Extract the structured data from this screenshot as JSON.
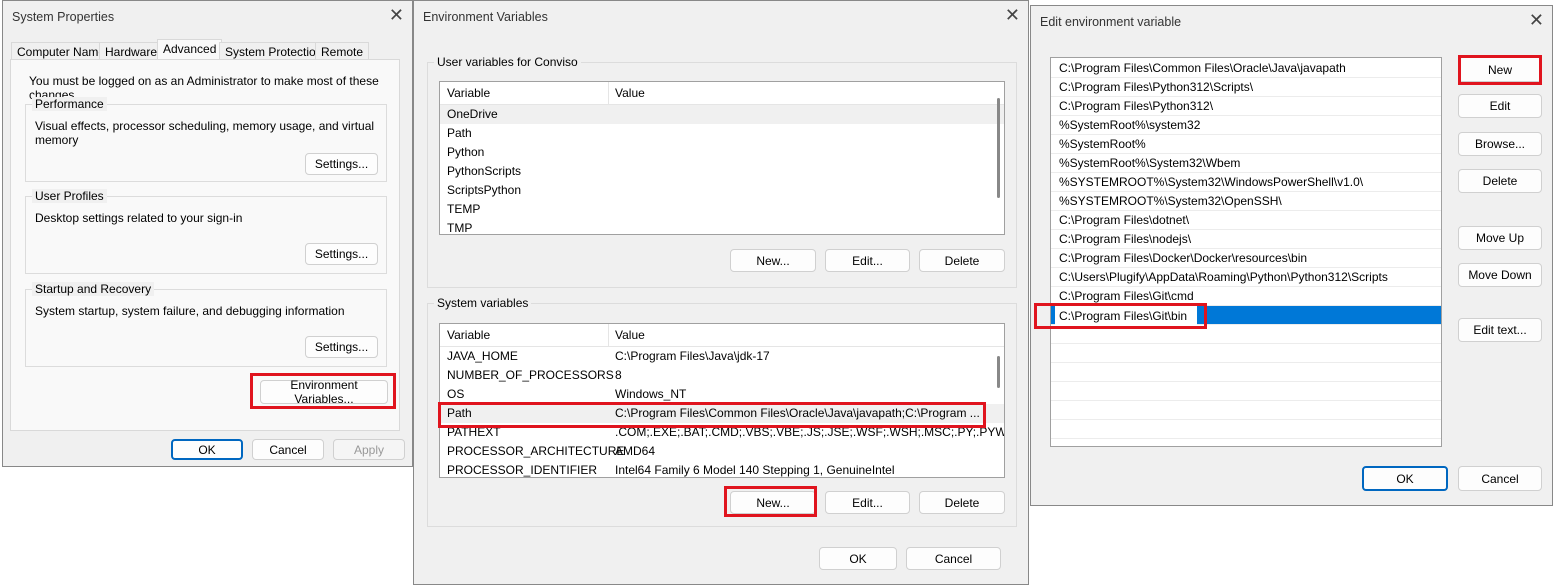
{
  "system_properties": {
    "title": "System Properties",
    "tabs": [
      "Computer Name",
      "Hardware",
      "Advanced",
      "System Protection",
      "Remote"
    ],
    "active_tab": "Advanced",
    "admin_note": "You must be logged on as an Administrator to make most of these changes.",
    "groups": [
      {
        "label": "Performance",
        "desc": "Visual effects, processor scheduling, memory usage, and virtual memory",
        "button": "Settings..."
      },
      {
        "label": "User Profiles",
        "desc": "Desktop settings related to your sign-in",
        "button": "Settings..."
      },
      {
        "label": "Startup and Recovery",
        "desc": "System startup, system failure, and debugging information",
        "button": "Settings..."
      }
    ],
    "env_button": "Environment Variables...",
    "ok": "OK",
    "cancel": "Cancel",
    "apply": "Apply"
  },
  "environment_variables": {
    "title": "Environment Variables",
    "user_group": "User variables for Conviso",
    "col_variable": "Variable",
    "col_value": "Value",
    "user_vars": [
      {
        "name": "OneDrive",
        "value": ""
      },
      {
        "name": "Path",
        "value": ""
      },
      {
        "name": "Python",
        "value": ""
      },
      {
        "name": "PythonScripts",
        "value": ""
      },
      {
        "name": "ScriptsPython",
        "value": ""
      },
      {
        "name": "TEMP",
        "value": ""
      },
      {
        "name": "TMP",
        "value": ""
      }
    ],
    "system_group": "System variables",
    "system_vars": [
      {
        "name": "JAVA_HOME",
        "value": "C:\\Program Files\\Java\\jdk-17"
      },
      {
        "name": "NUMBER_OF_PROCESSORS",
        "value": "8"
      },
      {
        "name": "OS",
        "value": "Windows_NT"
      },
      {
        "name": "Path",
        "value": "C:\\Program Files\\Common Files\\Oracle\\Java\\javapath;C:\\Program ..."
      },
      {
        "name": "PATHEXT",
        "value": ".COM;.EXE;.BAT;.CMD;.VBS;.VBE;.JS;.JSE;.WSF;.WSH;.MSC;.PY;.PYW"
      },
      {
        "name": "PROCESSOR_ARCHITECTURE",
        "value": "AMD64"
      },
      {
        "name": "PROCESSOR_IDENTIFIER",
        "value": "Intel64 Family 6 Model 140 Stepping 1, GenuineIntel"
      }
    ],
    "selected_system_var": "Path",
    "new": "New...",
    "edit": "Edit...",
    "delete": "Delete",
    "ok": "OK",
    "cancel": "Cancel"
  },
  "edit_env": {
    "title": "Edit environment variable",
    "entries": [
      "C:\\Program Files\\Common Files\\Oracle\\Java\\javapath",
      "C:\\Program Files\\Python312\\Scripts\\",
      "C:\\Program Files\\Python312\\",
      "%SystemRoot%\\system32",
      "%SystemRoot%",
      "%SystemRoot%\\System32\\Wbem",
      "%SYSTEMROOT%\\System32\\WindowsPowerShell\\v1.0\\",
      "%SYSTEMROOT%\\System32\\OpenSSH\\",
      "C:\\Program Files\\dotnet\\",
      "C:\\Program Files\\nodejs\\",
      "C:\\Program Files\\Docker\\Docker\\resources\\bin",
      "C:\\Users\\Plugify\\AppData\\Roaming\\Python\\Python312\\Scripts",
      "C:\\Program Files\\Git\\cmd"
    ],
    "editing_entry": "C:\\Program Files\\Git\\bin",
    "buttons": {
      "new": "New",
      "edit": "Edit",
      "browse": "Browse...",
      "delete": "Delete",
      "move_up": "Move Up",
      "move_down": "Move Down",
      "edit_text": "Edit text..."
    },
    "ok": "OK",
    "cancel": "Cancel"
  },
  "colors": {
    "highlight": "#e0141e",
    "selection": "#0078d7"
  }
}
